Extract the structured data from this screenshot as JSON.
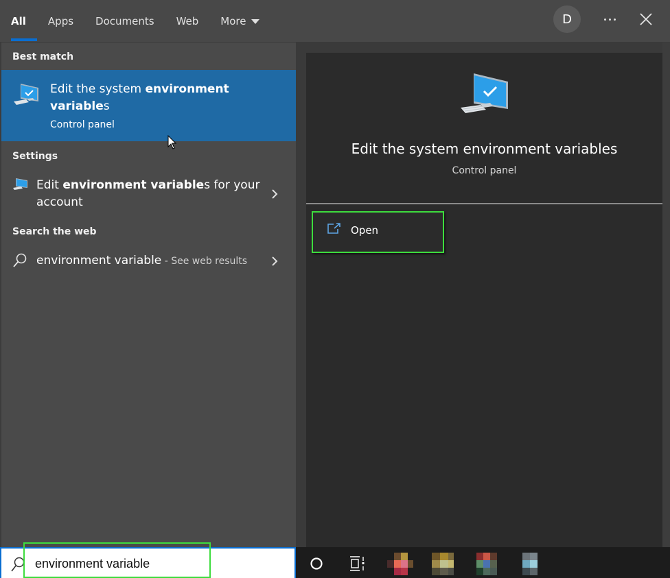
{
  "header": {
    "tabs": [
      {
        "label": "All",
        "active": true
      },
      {
        "label": "Apps",
        "active": false
      },
      {
        "label": "Documents",
        "active": false
      },
      {
        "label": "Web",
        "active": false
      },
      {
        "label": "More",
        "active": false,
        "has_dropdown": true
      }
    ],
    "avatar_initial": "D",
    "more_options_icon": "ellipsis-icon",
    "close_icon": "close-icon"
  },
  "results": {
    "best_match": {
      "section_label": "Best match",
      "title_pre": "Edit the system ",
      "title_bold": "environment variable",
      "title_post": "s",
      "subtitle": "Control panel",
      "icon": "computer-check-icon",
      "selected": true
    },
    "settings": {
      "section_label": "Settings",
      "items": [
        {
          "title_pre": "Edit ",
          "title_bold": "environment variable",
          "title_post": "s for your",
          "title_line2": "account",
          "icon": "computer-settings-icon"
        }
      ]
    },
    "web": {
      "section_label": "Search the web",
      "items": [
        {
          "query": "environment variable",
          "suffix": " - See web results",
          "icon": "search-icon"
        }
      ]
    }
  },
  "detail": {
    "title": "Edit the system environment variables",
    "subtitle": "Control panel",
    "icon": "computer-check-icon",
    "actions": [
      {
        "label": "Open",
        "icon": "open-external-icon",
        "highlighted": true
      }
    ]
  },
  "taskbar": {
    "search_value": "environment variable",
    "search_icon": "search-icon",
    "items": [
      {
        "name": "cortana",
        "icon": "circle-icon"
      },
      {
        "name": "task-view",
        "icon": "task-view-icon"
      },
      {
        "name": "app-1",
        "icon": "pixelated-app-icon"
      },
      {
        "name": "app-2",
        "icon": "pixelated-app-icon"
      },
      {
        "name": "app-3",
        "icon": "pixelated-app-icon"
      },
      {
        "name": "app-4",
        "icon": "pixelated-app-icon"
      }
    ]
  },
  "colors": {
    "accent": "#0a6ed1",
    "selected_bg": "#1f6aa5",
    "highlight_outline": "#3ddc3d"
  }
}
